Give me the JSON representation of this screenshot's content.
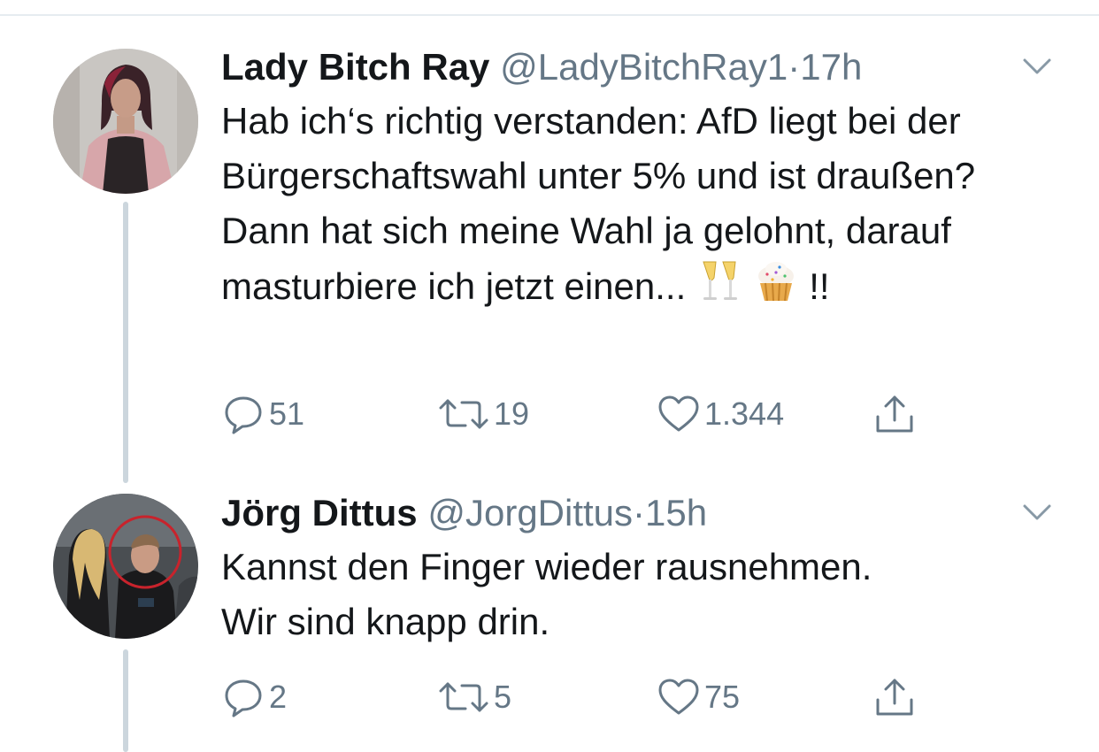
{
  "colors": {
    "text": "#14171a",
    "secondary": "#657786",
    "thread_line": "#ccd6dd",
    "divider": "#e6ecf0"
  },
  "tweets": [
    {
      "name": "Lady Bitch Ray",
      "handle": "@LadyBitchRay1",
      "separator": "·",
      "time": "17h",
      "text_main": "Hab ich‘s richtig verstanden: AfD liegt bei der Bürgerschaftswahl unter 5% und ist draußen? Dann hat sich meine Wahl ja gelohnt, darauf masturbiere ich jetzt einen...",
      "text_emojis": [
        "champagne-glasses",
        "cupcake"
      ],
      "text_end": "!!",
      "replies": "51",
      "retweets": "19",
      "likes": "1.344"
    },
    {
      "name": "Jörg Dittus",
      "handle": "@JorgDittus",
      "separator": "·",
      "time": "15h",
      "text_main": "Kannst den Finger wieder rausnehmen.\nWir sind knapp drin.",
      "replies": "2",
      "retweets": "5",
      "likes": "75"
    }
  ],
  "icons": {
    "reply": "reply-bubble-icon",
    "retweet": "retweet-icon",
    "like": "heart-icon",
    "share": "share-icon",
    "menu": "chevron-down-icon"
  }
}
